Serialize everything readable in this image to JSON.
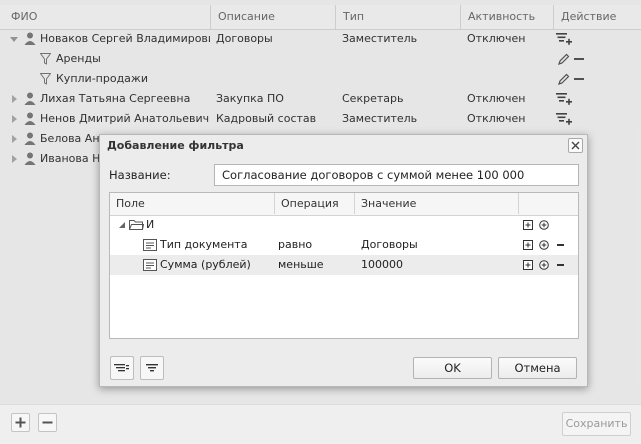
{
  "grid": {
    "columns": [
      "ФИО",
      "Описание",
      "Тип",
      "Активность",
      "Действие"
    ],
    "rows": [
      {
        "name": "Новаков Сергей Владимирович",
        "desc": "Договоры",
        "type": "Заместитель",
        "status": "Отключен"
      },
      {
        "name": "Аренды"
      },
      {
        "name": "Купли-продажи"
      },
      {
        "name": "Лихая Татьяна Сергеевна",
        "desc": "Закупка ПО",
        "type": "Секретарь",
        "status": "Отключен"
      },
      {
        "name": "Ненов Дмитрий Анатольевич",
        "desc": "Кадровый состав",
        "type": "Заместитель",
        "status": "Отключен"
      },
      {
        "name": "Белова Ана"
      },
      {
        "name": "Иванова На"
      }
    ]
  },
  "bottom": {
    "save_label": "Сохранить"
  },
  "dialog": {
    "title": "Добавление фильтра",
    "name_label": "Название:",
    "name_value": "Согласование договоров с суммой менее 100 000",
    "tree_columns": [
      "Поле",
      "Операция",
      "Значение"
    ],
    "tree_rows": [
      {
        "field": "И"
      },
      {
        "field": "Тип документа",
        "op": "равно",
        "value": "Договоры"
      },
      {
        "field": "Сумма (рублей)",
        "op": "меньше",
        "value": "100000"
      }
    ],
    "ok_label": "OK",
    "cancel_label": "Отмена"
  }
}
